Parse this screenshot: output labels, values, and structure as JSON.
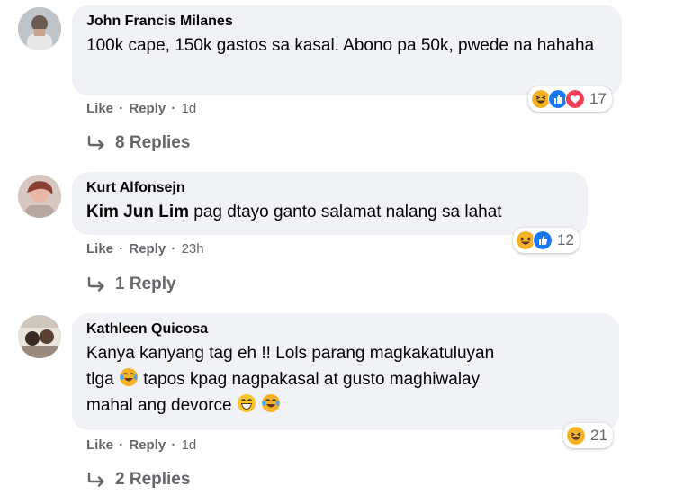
{
  "comments": [
    {
      "author": "John Francis Milanes",
      "text": "100k cape, 150k gastos sa kasal. Abono pa 50k, pwede na hahaha",
      "actions": {
        "like": "Like",
        "reply": "Reply",
        "time": "1d"
      },
      "reactions": {
        "icons": [
          "haha-icon",
          "like-icon",
          "love-icon"
        ],
        "count": "17"
      },
      "replies": "8 Replies"
    },
    {
      "author": "Kurt Alfonsejn",
      "mention": "Kim Jun Lim",
      "text": " pag dtayo ganto salamat nalang sa lahat",
      "actions": {
        "like": "Like",
        "reply": "Reply",
        "time": "23h"
      },
      "reactions": {
        "icons": [
          "haha-icon",
          "like-icon"
        ],
        "count": "12"
      },
      "replies": "1 Reply"
    },
    {
      "author": "Kathleen Quicosa",
      "text_line1": "Kanya kanyang tag eh !! Lols parang magkakatuluyan",
      "text_line2a": "tlga ",
      "text_line2b": " tapos kpag nagpakasal at gusto maghiwalay",
      "text_line3": "mahal ang devorce ",
      "actions": {
        "like": "Like",
        "reply": "Reply",
        "time": "1d"
      },
      "reactions": {
        "icons": [
          "haha-icon"
        ],
        "count": "21"
      },
      "replies": "2 Replies"
    }
  ],
  "colors": {
    "bubble": "#f0f2f5",
    "secondary_text": "#65676b",
    "like_blue": "#1877f2",
    "love_red": "#f33e58",
    "haha_yellow": "#f7b125"
  }
}
